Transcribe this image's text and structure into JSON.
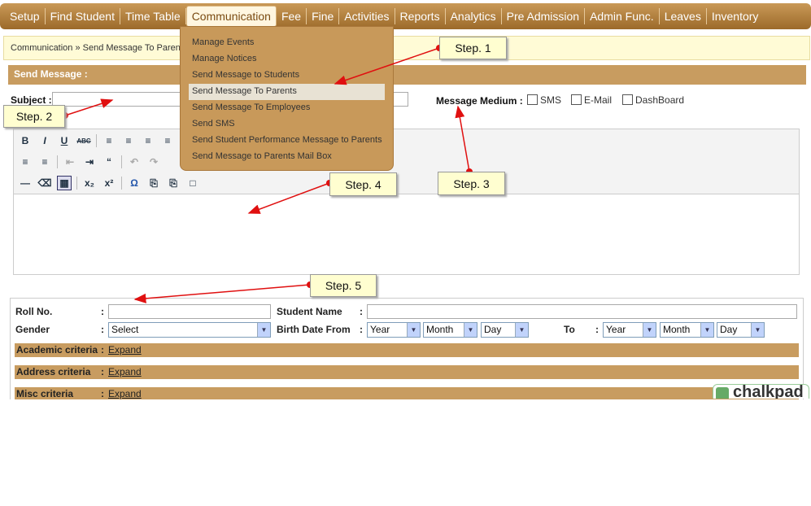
{
  "nav": {
    "items": [
      "Setup",
      "Find Student",
      "Time Table",
      "Communication",
      "Fee",
      "Fine",
      "Activities",
      "Reports",
      "Analytics",
      "Pre Admission",
      "Admin Func.",
      "Leaves",
      "Inventory"
    ]
  },
  "breadcrumb": "Communication » Send Message To Parents",
  "dropdown": {
    "items": [
      "Manage Events",
      "Manage Notices",
      "Send Message to Students",
      "Send Message To Parents",
      "Send Message To Employees",
      "Send SMS",
      "Send Student Performance Message to Parents",
      "Send Message to Parents Mail Box"
    ],
    "highlighted": "Send Message To Parents"
  },
  "panel": {
    "title": "Send Message :"
  },
  "subject": {
    "label": "Subject :",
    "value": ""
  },
  "medium": {
    "label": "Message Medium :",
    "options": [
      "SMS",
      "E-Mail",
      "DashBoard"
    ]
  },
  "editor": {
    "toolbar_row1": [
      "B",
      "I",
      "U",
      "ABC"
    ],
    "toolbar_row3_symbols": [
      "x₂",
      "x²",
      "Ω"
    ]
  },
  "search": {
    "roll_label": "Roll No.",
    "student_name_label": "Student Name",
    "gender_label": "Gender",
    "gender_value": "Select",
    "birth_label": "Birth Date From",
    "to_label": "To",
    "year": "Year",
    "month": "Month",
    "day": "Day",
    "colon": ":"
  },
  "criteria": [
    {
      "label": "Academic criteria",
      "link": "Expand"
    },
    {
      "label": "Address criteria",
      "link": "Expand"
    },
    {
      "label": "Misc criteria",
      "link": "Expand"
    }
  ],
  "logo_text": "chalkpad",
  "callouts": [
    "Step. 1",
    "Step. 2",
    "Step. 3",
    "Step. 4",
    "Step. 5"
  ],
  "colors": {
    "nav_brown": "#b07f3d",
    "panel_tan": "#c89c60",
    "arrow_red": "#e01010",
    "callout_yellow": "#fffed0"
  }
}
